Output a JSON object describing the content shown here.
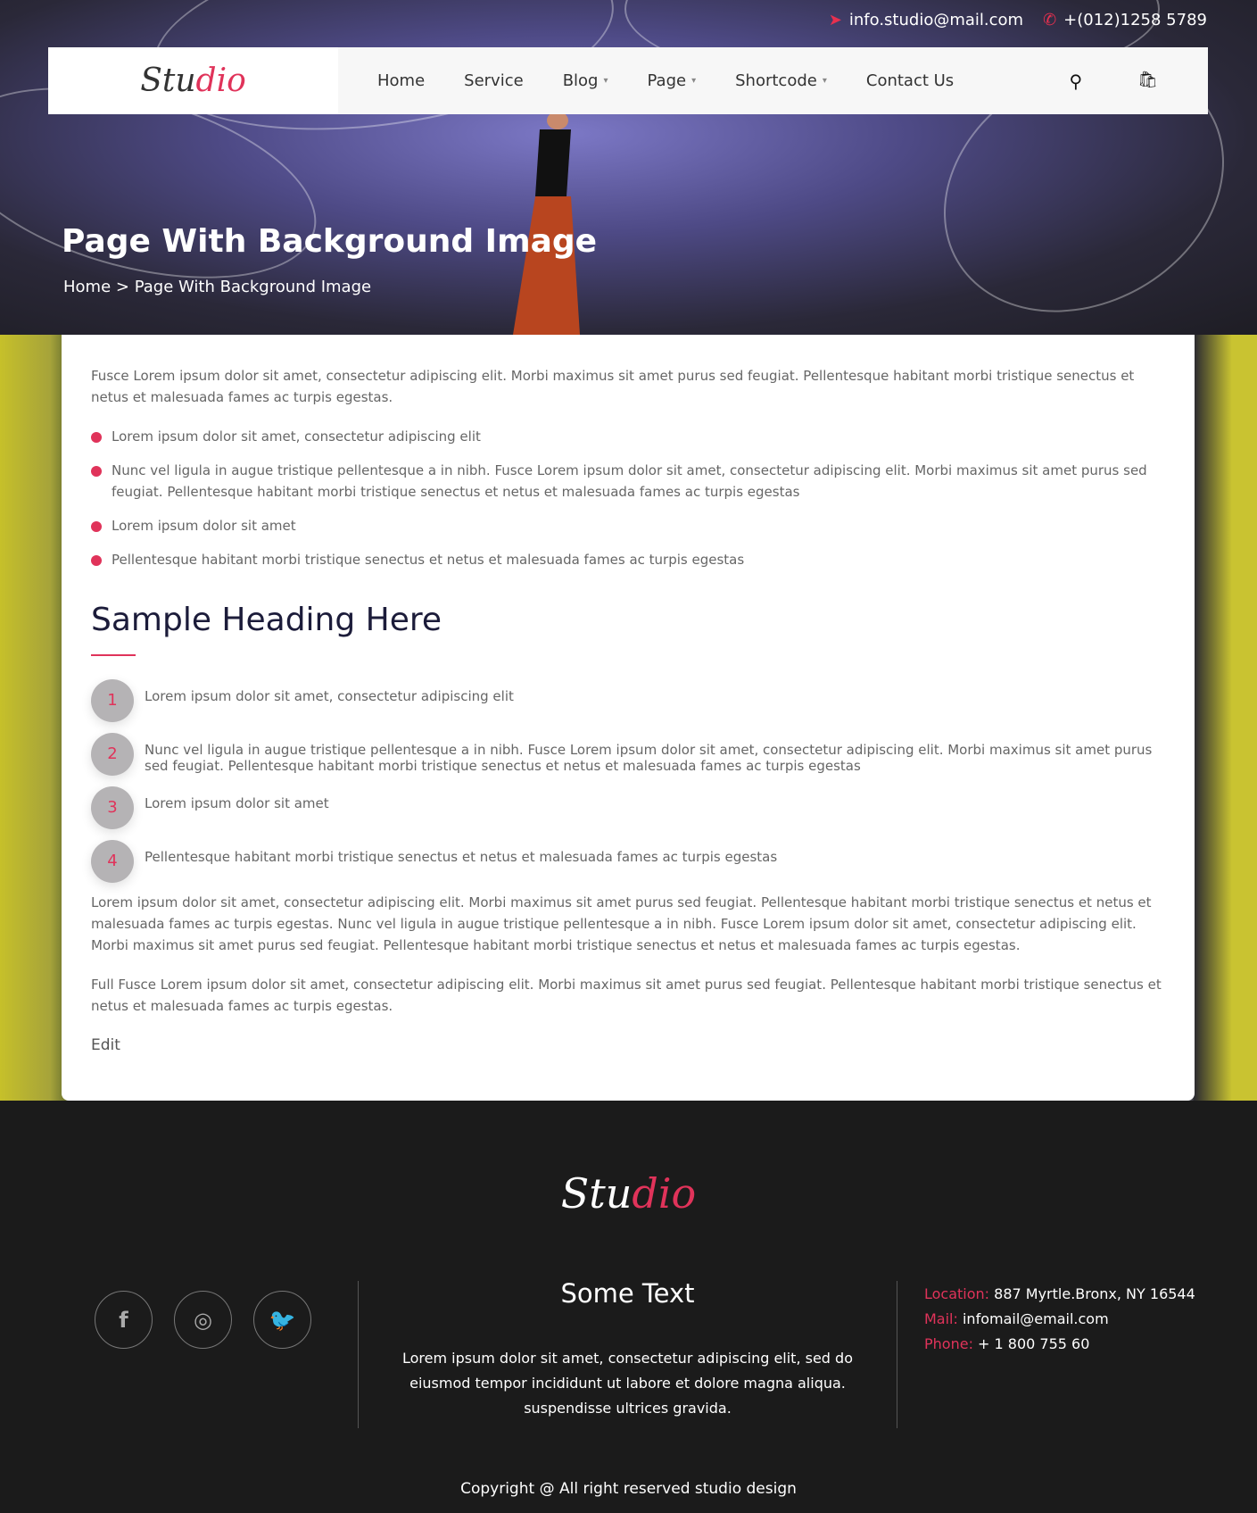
{
  "topbar": {
    "email": "info.studio@mail.com",
    "phone": "+(012)1258 5789",
    "email_icon": "paper-plane-icon",
    "phone_icon": "phone-icon"
  },
  "logo": {
    "main": "Stu",
    "accent": "dio"
  },
  "nav": {
    "items": [
      {
        "label": "Home",
        "dropdown": false
      },
      {
        "label": "Service",
        "dropdown": false
      },
      {
        "label": "Blog",
        "dropdown": true
      },
      {
        "label": "Page",
        "dropdown": true
      },
      {
        "label": "Shortcode",
        "dropdown": true
      },
      {
        "label": "Contact Us",
        "dropdown": false
      }
    ],
    "caret": "▾",
    "search_icon": "⚲",
    "cart_icon": "🛍"
  },
  "hero": {
    "title": "Page With Background Image",
    "breadcrumb": {
      "home": "Home",
      "sep": ">",
      "current": "Page With Background Image"
    }
  },
  "content": {
    "intro": "Fusce Lorem ipsum dolor sit amet, consectetur adipiscing elit. Morbi maximus sit amet purus sed feugiat. Pellentesque habitant morbi tristique senectus et netus et malesuada fames ac turpis egestas.",
    "bullets": [
      "Lorem ipsum dolor sit amet, consectetur adipiscing elit",
      "Nunc vel ligula in augue tristique pellentesque a in nibh. Fusce Lorem ipsum dolor sit amet, consectetur adipiscing elit. Morbi maximus sit amet purus sed feugiat. Pellentesque habitant morbi tristique senectus et netus et malesuada fames ac turpis egestas",
      "Lorem ipsum dolor sit amet",
      "Pellentesque habitant morbi tristique senectus et netus et malesuada fames ac turpis egestas"
    ],
    "heading": "Sample Heading Here",
    "numbered": [
      {
        "n": "1",
        "text": "Lorem ipsum dolor sit amet, consectetur adipiscing elit"
      },
      {
        "n": "2",
        "text": "Nunc vel ligula in augue tristique pellentesque a in nibh. Fusce Lorem ipsum dolor sit amet, consectetur adipiscing elit. Morbi maximus sit amet purus sed feugiat. Pellentesque habitant morbi tristique senectus et netus et malesuada fames ac turpis egestas"
      },
      {
        "n": "3",
        "text": "Lorem ipsum dolor sit amet"
      },
      {
        "n": "4",
        "text": "Pellentesque habitant morbi tristique senectus et netus et malesuada fames ac turpis egestas"
      }
    ],
    "para2": "Lorem ipsum dolor sit amet, consectetur adipiscing elit. Morbi maximus sit amet purus sed feugiat. Pellentesque habitant morbi tristique senectus et netus et malesuada fames ac turpis egestas. Nunc vel ligula in augue tristique pellentesque a in nibh. Fusce Lorem ipsum dolor sit amet, consectetur adipiscing elit. Morbi maximus sit amet purus sed feugiat. Pellentesque habitant morbi tristique senectus et netus et malesuada fames ac turpis egestas.",
    "para3": "Full Fusce Lorem ipsum dolor sit amet, consectetur adipiscing elit. Morbi maximus sit amet purus sed feugiat. Pellentesque habitant morbi tristique senectus et netus et malesuada fames ac turpis egestas.",
    "edit": "Edit"
  },
  "footer": {
    "socials": [
      {
        "name": "facebook-icon",
        "glyph": "f"
      },
      {
        "name": "instagram-icon",
        "glyph": "◎"
      },
      {
        "name": "twitter-icon",
        "glyph": "🐦"
      }
    ],
    "title": "Some Text",
    "text": "Lorem ipsum dolor sit amet, consectetur adipiscing elit, sed do eiusmod tempor incididunt ut labore et dolore magna aliqua. suspendisse ultrices gravida.",
    "contact": [
      {
        "label": "Location:",
        "value": "887 Myrtle.Bronx, NY 16544"
      },
      {
        "label": "Mail:",
        "value": "infomail@email.com"
      },
      {
        "label": "Phone:",
        "value": "+ 1 800 755 60"
      }
    ],
    "copyright": "Copyright @ All right reserved studio design"
  },
  "colors": {
    "accent": "#e0335a",
    "footer_bg": "#1b1b1b",
    "heading": "#1c1c3a"
  }
}
